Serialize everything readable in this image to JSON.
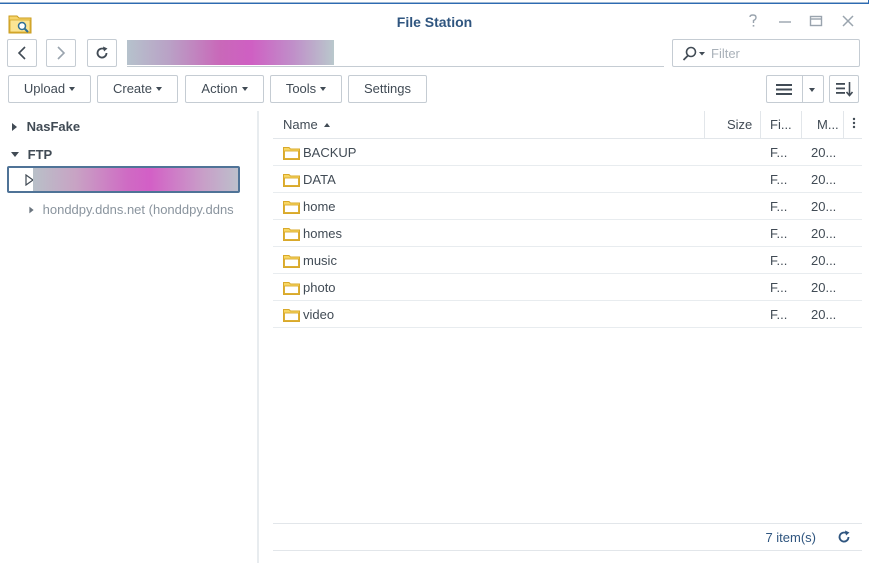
{
  "window": {
    "title": "File Station",
    "help_icon": "question-icon",
    "minimize_icon": "minimize-icon",
    "maximize_icon": "maximize-icon",
    "close_icon": "close-icon",
    "accent_color": "#2f557f"
  },
  "nav": {
    "back_icon": "chevron-left-icon",
    "forward_icon": "chevron-right-icon",
    "refresh_icon": "refresh-icon",
    "path": ""
  },
  "filter": {
    "placeholder": "Filter",
    "icon": "search-icon"
  },
  "toolbar": {
    "upload_label": "Upload",
    "create_label": "Create",
    "action_label": "Action",
    "tools_label": "Tools",
    "settings_label": "Settings",
    "view_icon": "list-view-icon",
    "sort_icon": "sort-icon"
  },
  "sidebar": {
    "nodes": [
      {
        "label": "NasFake",
        "expanded": false
      },
      {
        "label": "FTP",
        "expanded": true
      },
      {
        "label": "",
        "selected": true
      },
      {
        "label": "honddpy.ddns.net (honddpy.ddns"
      }
    ]
  },
  "filelist": {
    "columns": [
      "Name",
      "Size",
      "Fi...",
      "M..."
    ],
    "sort_column": "Name",
    "sort_direction": "ascending",
    "rows": [
      {
        "name": "BACKUP",
        "size": "",
        "type": "F...",
        "modified": "20..."
      },
      {
        "name": "DATA",
        "size": "",
        "type": "F...",
        "modified": "20..."
      },
      {
        "name": "home",
        "size": "",
        "type": "F...",
        "modified": "20..."
      },
      {
        "name": "homes",
        "size": "",
        "type": "F...",
        "modified": "20..."
      },
      {
        "name": "music",
        "size": "",
        "type": "F...",
        "modified": "20..."
      },
      {
        "name": "photo",
        "size": "",
        "type": "F...",
        "modified": "20..."
      },
      {
        "name": "video",
        "size": "",
        "type": "F...",
        "modified": "20..."
      }
    ]
  },
  "status": {
    "item_count": "7 item(s)",
    "refresh_icon": "refresh-icon"
  }
}
